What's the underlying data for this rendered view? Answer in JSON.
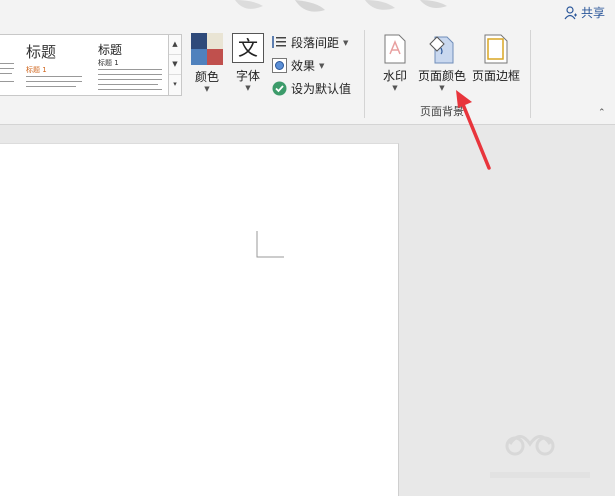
{
  "header": {
    "share_label": "共享"
  },
  "styles_gallery": {
    "items": [
      {
        "title": "标题",
        "heading1": "标题 1"
      },
      {
        "title": "标题",
        "heading1": "标题 1"
      }
    ]
  },
  "ribbon": {
    "colors_label": "颜色",
    "fonts_label": "字体",
    "fonts_glyph": "文",
    "paragraph_spacing_label": "段落间距",
    "effects_label": "效果",
    "set_default_label": "设为默认值",
    "watermark_label": "水印",
    "page_color_label": "页面颜色",
    "page_borders_label": "页面边框",
    "group_page_background": "页面背景"
  },
  "colors": {
    "accent_blue": "#2b579a",
    "arrow_red": "#e8353c",
    "theme_swatch": [
      "#2f4a7a",
      "#e9e4d4",
      "#4f81bd",
      "#c0504d"
    ],
    "heading_orange": "#d0661e"
  }
}
